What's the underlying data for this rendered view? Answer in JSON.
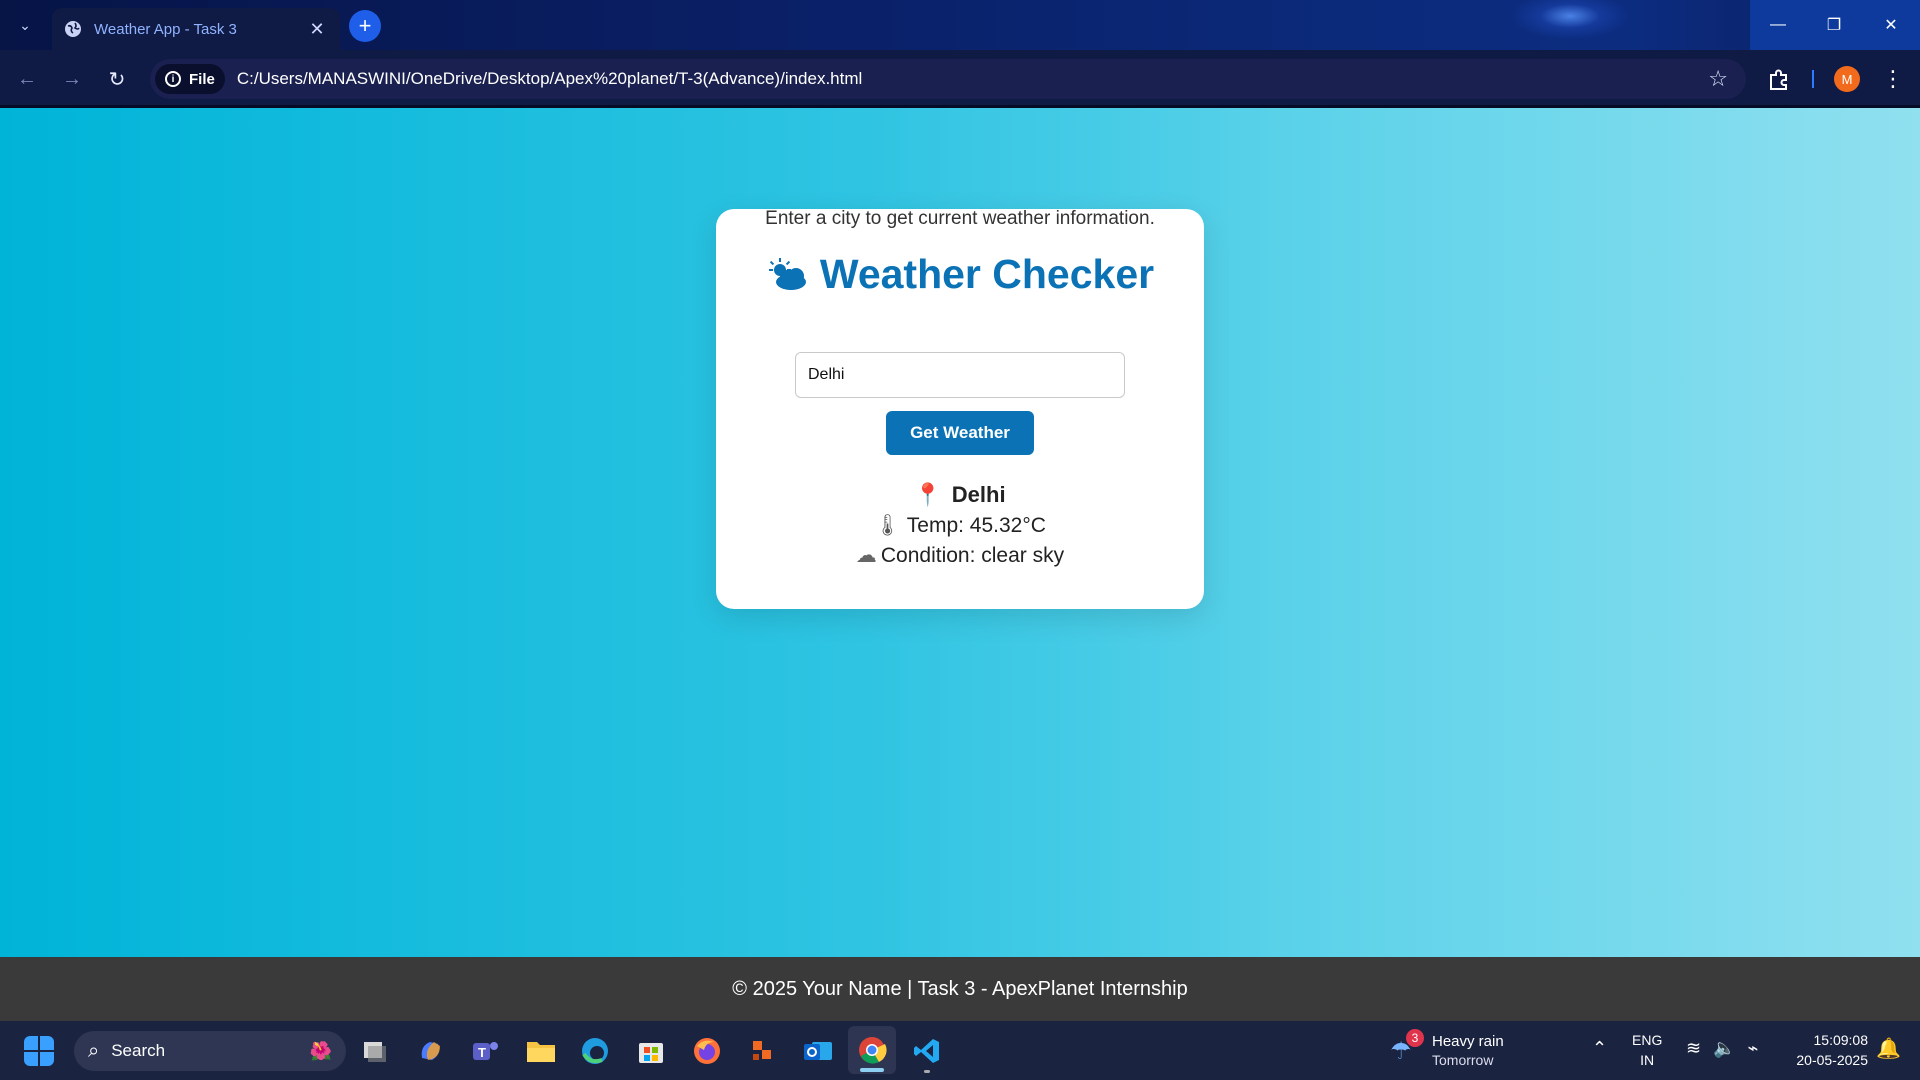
{
  "browser": {
    "tab_title": "Weather App - Task 3",
    "tab_close": "✕",
    "new_tab": "+",
    "file_chip": "File",
    "url": "C:/Users/MANASWINI/OneDrive/Desktop/Apex%20planet/T-3(Advance)/index.html",
    "avatar_initial": "M"
  },
  "app": {
    "title": "Weather Checker",
    "subtitle": "Enter a city to get current weather information.",
    "input_value": "Delhi",
    "button_label": "Get Weather",
    "result": {
      "city": "Delhi",
      "temp": "Temp: 45.32°C",
      "condition": "Condition: clear sky"
    },
    "accent_color": "#0a72b5"
  },
  "footer": {
    "text": "© 2025 Your Name | Task 3 - ApexPlanet Internship"
  },
  "taskbar": {
    "search_label": "Search",
    "weather_badge": "3",
    "weather_main": "Heavy rain",
    "weather_sub": "Tomorrow",
    "lang_line1": "ENG",
    "lang_line2": "IN",
    "time": "15:09:08",
    "date": "20-05-2025"
  }
}
